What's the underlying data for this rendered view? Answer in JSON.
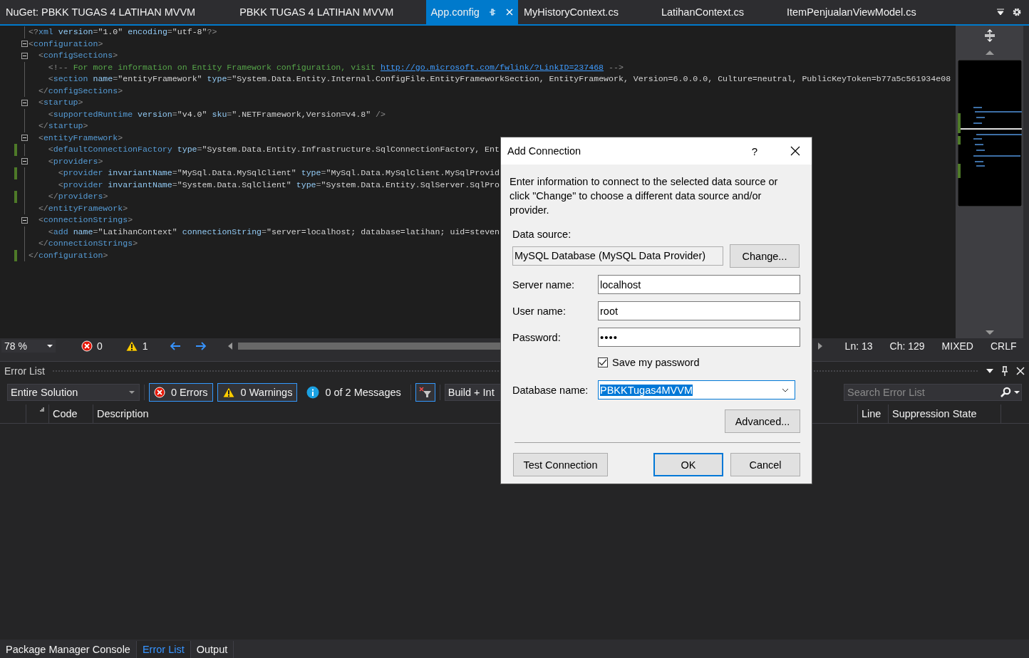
{
  "tabs": [
    {
      "label": "NuGet: PBKK TUGAS 4 LATIHAN MVVM",
      "selected": false
    },
    {
      "label": "PBKK TUGAS 4 LATIHAN MVVM",
      "selected": false
    },
    {
      "label": "App.config",
      "selected": true
    },
    {
      "label": "MyHistoryContext.cs",
      "selected": false
    },
    {
      "label": "LatihanContext.cs",
      "selected": false
    },
    {
      "label": "ItemPenjualanViewModel.cs",
      "selected": false
    }
  ],
  "editor": {
    "lines": [
      {
        "fold": false,
        "changed": false,
        "tokens": [
          {
            "kind": "p",
            "text": "<?"
          },
          {
            "kind": "t",
            "text": "xml"
          },
          {
            "kind": "a",
            "text": " version"
          },
          {
            "kind": "p",
            "text": "="
          },
          {
            "kind": "s",
            "text": "\"1.0\""
          },
          {
            "kind": "a",
            "text": " encoding"
          },
          {
            "kind": "p",
            "text": "="
          },
          {
            "kind": "s",
            "text": "\"utf-8\""
          },
          {
            "kind": "p",
            "text": "?>"
          }
        ]
      },
      {
        "fold": true,
        "changed": false,
        "tokens": [
          {
            "kind": "p",
            "text": "<"
          },
          {
            "kind": "t",
            "text": "configuration"
          },
          {
            "kind": "p",
            "text": ">"
          }
        ]
      },
      {
        "fold": true,
        "changed": false,
        "tokens": [
          {
            "kind": "p",
            "text": "  <"
          },
          {
            "kind": "t",
            "text": "configSections"
          },
          {
            "kind": "p",
            "text": ">"
          }
        ]
      },
      {
        "fold": false,
        "changed": false,
        "tokens": [
          {
            "kind": "p",
            "text": "    <!--"
          },
          {
            "kind": "c",
            "text": " For more information on Entity Framework configuration, visit "
          },
          {
            "kind": "l",
            "text": "http://go.microsoft.com/fwlink/?LinkID=237468"
          },
          {
            "kind": "p",
            "text": " -->"
          }
        ]
      },
      {
        "fold": false,
        "changed": false,
        "tokens": [
          {
            "kind": "p",
            "text": "    <"
          },
          {
            "kind": "t",
            "text": "section"
          },
          {
            "kind": "a",
            "text": " name"
          },
          {
            "kind": "p",
            "text": "="
          },
          {
            "kind": "s",
            "text": "\"entityFramework\""
          },
          {
            "kind": "a",
            "text": " type"
          },
          {
            "kind": "p",
            "text": "="
          },
          {
            "kind": "s",
            "text": "\"System.Data.Entity.Internal.ConfigFile.EntityFrameworkSection, EntityFramework, Version=6.0.0.0, Culture=neutral, PublicKeyToken=b77a5c561934e08"
          }
        ]
      },
      {
        "fold": false,
        "changed": false,
        "tokens": [
          {
            "kind": "p",
            "text": "  </"
          },
          {
            "kind": "t",
            "text": "configSections"
          },
          {
            "kind": "p",
            "text": ">"
          }
        ]
      },
      {
        "fold": true,
        "changed": false,
        "tokens": [
          {
            "kind": "p",
            "text": "  <"
          },
          {
            "kind": "t",
            "text": "startup"
          },
          {
            "kind": "p",
            "text": ">"
          }
        ]
      },
      {
        "fold": false,
        "changed": false,
        "tokens": [
          {
            "kind": "p",
            "text": "    <"
          },
          {
            "kind": "t",
            "text": "supportedRuntime"
          },
          {
            "kind": "a",
            "text": " version"
          },
          {
            "kind": "p",
            "text": "="
          },
          {
            "kind": "s",
            "text": "\"v4.0\""
          },
          {
            "kind": "a",
            "text": " sku"
          },
          {
            "kind": "p",
            "text": "="
          },
          {
            "kind": "s",
            "text": "\".NETFramework,Version=v4.8\""
          },
          {
            "kind": "p",
            "text": " />"
          }
        ]
      },
      {
        "fold": false,
        "changed": false,
        "tokens": [
          {
            "kind": "p",
            "text": "  </"
          },
          {
            "kind": "t",
            "text": "startup"
          },
          {
            "kind": "p",
            "text": ">"
          }
        ]
      },
      {
        "fold": true,
        "changed": false,
        "tokens": [
          {
            "kind": "p",
            "text": "  <"
          },
          {
            "kind": "t",
            "text": "entityFramework"
          },
          {
            "kind": "p",
            "text": ">"
          }
        ]
      },
      {
        "fold": false,
        "changed": true,
        "tokens": [
          {
            "kind": "p",
            "text": "    <"
          },
          {
            "kind": "t",
            "text": "defaultConnectionFactory"
          },
          {
            "kind": "a",
            "text": " type"
          },
          {
            "kind": "p",
            "text": "="
          },
          {
            "kind": "s",
            "text": "\"System.Data.Entity.Infrastructure.SqlConnectionFactory, Ent"
          }
        ]
      },
      {
        "fold": true,
        "changed": false,
        "tokens": [
          {
            "kind": "p",
            "text": "    <"
          },
          {
            "kind": "t",
            "text": "providers"
          },
          {
            "kind": "p",
            "text": ">"
          }
        ]
      },
      {
        "fold": false,
        "changed": true,
        "tokens": [
          {
            "kind": "p",
            "text": "      <"
          },
          {
            "kind": "t",
            "text": "provider"
          },
          {
            "kind": "a",
            "text": " invariantName"
          },
          {
            "kind": "p",
            "text": "="
          },
          {
            "kind": "s",
            "text": "\"MySql.Data.MySqlClient\""
          },
          {
            "kind": "a",
            "text": " type"
          },
          {
            "kind": "p",
            "text": "="
          },
          {
            "kind": "s",
            "text": "\"MySql.Data.MySqlClient.MySqlProvid"
          }
        ]
      },
      {
        "fold": false,
        "changed": false,
        "tokens": [
          {
            "kind": "p",
            "text": "      <"
          },
          {
            "kind": "t",
            "text": "provider"
          },
          {
            "kind": "a",
            "text": " invariantName"
          },
          {
            "kind": "p",
            "text": "="
          },
          {
            "kind": "s",
            "text": "\"System.Data.SqlClient\""
          },
          {
            "kind": "a",
            "text": " type"
          },
          {
            "kind": "p",
            "text": "="
          },
          {
            "kind": "s",
            "text": "\"System.Data.Entity.SqlServer.SqlPro"
          }
        ]
      },
      {
        "fold": false,
        "changed": true,
        "tokens": [
          {
            "kind": "p",
            "text": "    </"
          },
          {
            "kind": "t",
            "text": "providers"
          },
          {
            "kind": "p",
            "text": ">"
          }
        ]
      },
      {
        "fold": false,
        "changed": false,
        "tokens": [
          {
            "kind": "p",
            "text": "  </"
          },
          {
            "kind": "t",
            "text": "entityFramework"
          },
          {
            "kind": "p",
            "text": ">"
          }
        ]
      },
      {
        "fold": true,
        "changed": false,
        "tokens": [
          {
            "kind": "p",
            "text": "  <"
          },
          {
            "kind": "t",
            "text": "connectionStrings"
          },
          {
            "kind": "p",
            "text": ">"
          }
        ]
      },
      {
        "fold": false,
        "changed": false,
        "tokens": [
          {
            "kind": "p",
            "text": "    <"
          },
          {
            "kind": "t",
            "text": "add"
          },
          {
            "kind": "a",
            "text": " name"
          },
          {
            "kind": "p",
            "text": "="
          },
          {
            "kind": "s",
            "text": "\"LatihanContext\""
          },
          {
            "kind": "a",
            "text": " connectionString"
          },
          {
            "kind": "p",
            "text": "="
          },
          {
            "kind": "s",
            "text": "\"server=localhost; database=latihan; uid=steven"
          }
        ]
      },
      {
        "fold": false,
        "changed": false,
        "tokens": [
          {
            "kind": "p",
            "text": "  </"
          },
          {
            "kind": "t",
            "text": "connectionStrings"
          },
          {
            "kind": "p",
            "text": ">"
          }
        ]
      },
      {
        "fold": false,
        "changed": true,
        "tokens": [
          {
            "kind": "p",
            "text": "</"
          },
          {
            "kind": "t",
            "text": "configuration"
          },
          {
            "kind": "p",
            "text": ">"
          }
        ]
      }
    ]
  },
  "editor_status": {
    "zoom": "78 %",
    "errors": "0",
    "warnings": "1",
    "items": [
      "Ln: 13",
      "Ch: 129",
      "MIXED",
      "CRLF"
    ]
  },
  "error_list": {
    "title": "Error List",
    "scope": "Entire Solution",
    "filters": [
      {
        "kind": "error",
        "label": "0 Errors",
        "on": true
      },
      {
        "kind": "warning",
        "label": "0 Warnings",
        "on": true
      },
      {
        "kind": "info",
        "label": "0 of 2 Messages",
        "on": false
      }
    ],
    "clear_filter_on": true,
    "source": "Build + Int",
    "search_placeholder": "Search Error List",
    "columns": [
      "Code",
      "Description",
      "Line",
      "Suppression State"
    ]
  },
  "bottom_tabs": [
    {
      "label": "Package Manager Console",
      "selected": false
    },
    {
      "label": "Error List",
      "selected": true
    },
    {
      "label": "Output",
      "selected": false
    }
  ],
  "dialog": {
    "title": "Add Connection",
    "help": "?",
    "intro": "Enter information to connect to the selected data source or click \"Change\" to choose a different data source and/or provider.",
    "data_source_label": "Data source:",
    "data_source": "MySQL Database (MySQL Data Provider)",
    "change_button": "Change...",
    "fields": [
      {
        "kind": "text",
        "label": "Server name:",
        "value": "localhost"
      },
      {
        "kind": "text",
        "label": "User name:",
        "value": "root"
      },
      {
        "kind": "password",
        "label": "Password:",
        "value": "••••"
      }
    ],
    "save_password": {
      "label": "Save my password",
      "checked": true
    },
    "database": {
      "label": "Database name:",
      "value": "PBKKTugas4MVVM",
      "highlighted": true
    },
    "advanced_button": "Advanced...",
    "buttons": [
      {
        "label": "Test Connection",
        "default": false
      },
      {
        "label": "OK",
        "default": true
      },
      {
        "label": "Cancel",
        "default": false
      }
    ]
  }
}
